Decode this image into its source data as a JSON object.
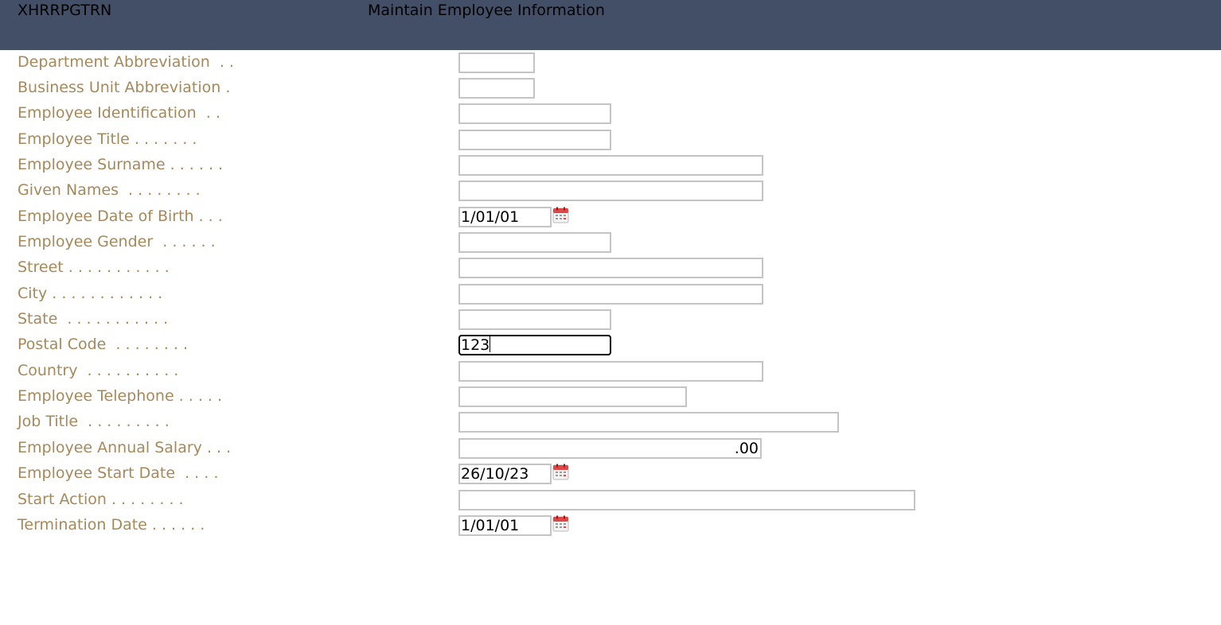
{
  "header": {
    "program_id": "XHRRPGTRN",
    "title": "Maintain Employee Information"
  },
  "form": {
    "department_abbreviation": {
      "label": "Department Abbreviation  . .",
      "value": ""
    },
    "business_unit_abbreviation": {
      "label": "Business Unit Abbreviation .",
      "value": ""
    },
    "employee_identification": {
      "label": "Employee Identification  . .",
      "value": ""
    },
    "employee_title": {
      "label": "Employee Title . . . . . . .",
      "value": ""
    },
    "employee_surname": {
      "label": "Employee Surname . . . . . .",
      "value": ""
    },
    "given_names": {
      "label": "Given Names  . . . . . . . .",
      "value": ""
    },
    "date_of_birth": {
      "label": "Employee Date of Birth . . .",
      "value": "1/01/01"
    },
    "employee_gender": {
      "label": "Employee Gender  . . . . . .",
      "value": ""
    },
    "street": {
      "label": "Street . . . . . . . . . . .",
      "value": ""
    },
    "city": {
      "label": "City . . . . . . . . . . . .",
      "value": ""
    },
    "state": {
      "label": "State  . . . . . . . . . . .",
      "value": ""
    },
    "postal_code": {
      "label": "Postal Code  . . . . . . . .",
      "value": "123"
    },
    "country": {
      "label": "Country  . . . . . . . . . .",
      "value": ""
    },
    "employee_telephone": {
      "label": "Employee Telephone . . . . .",
      "value": ""
    },
    "job_title": {
      "label": "Job Title  . . . . . . . . .",
      "value": ""
    },
    "annual_salary": {
      "label": "Employee Annual Salary . . .",
      "value": ".00"
    },
    "start_date": {
      "label": "Employee Start Date  . . . .",
      "value": "26/10/23"
    },
    "start_action": {
      "label": "Start Action . . . . . . . .",
      "value": ""
    },
    "termination_date": {
      "label": "Termination Date . . . . . .",
      "value": "1/01/01"
    }
  },
  "icons": {
    "calendar": "calendar-icon"
  },
  "colors": {
    "header_bg": "#434f66",
    "label": "#a5895a",
    "input_border": "#c4c4c4",
    "calendar_accent": "#e04848"
  }
}
